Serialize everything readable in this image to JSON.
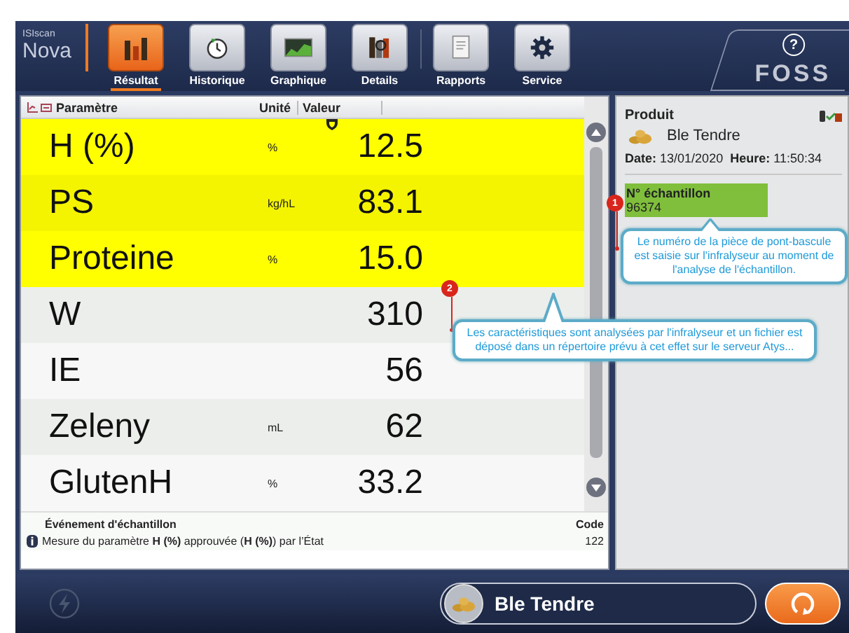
{
  "app": {
    "logo_small": "ISIscan",
    "logo_large": "Nova",
    "brand": "FOSS",
    "help": "?"
  },
  "tabs": [
    {
      "label": "Résultat",
      "selected": true
    },
    {
      "label": "Historique",
      "selected": false
    },
    {
      "label": "Graphique",
      "selected": false
    },
    {
      "label": "Details",
      "selected": false
    }
  ],
  "tools": [
    {
      "label": "Rapports"
    },
    {
      "label": "Service"
    }
  ],
  "table": {
    "columns": [
      "Paramètre",
      "Unité",
      "Valeur"
    ],
    "rows": [
      {
        "name": "H (%)",
        "unit": "%",
        "value": "12.5",
        "highlighted": true,
        "flagged": true
      },
      {
        "name": "PS",
        "unit": "kg/hL",
        "value": "83.1",
        "highlighted": true,
        "flagged": false
      },
      {
        "name": "Proteine",
        "unit": "%",
        "value": "15.0",
        "highlighted": true,
        "flagged": false
      },
      {
        "name": "W",
        "unit": "",
        "value": "310",
        "highlighted": false,
        "flagged": false
      },
      {
        "name": "IE",
        "unit": "",
        "value": "56",
        "highlighted": false,
        "flagged": false
      },
      {
        "name": "Zeleny",
        "unit": "mL",
        "value": "62",
        "highlighted": false,
        "flagged": false
      },
      {
        "name": "GlutenH",
        "unit": "%",
        "value": "33.2",
        "highlighted": false,
        "flagged": false
      }
    ]
  },
  "events": {
    "heading": "Événement d'échantillon",
    "code_heading": "Code",
    "rows": [
      {
        "text": "Mesure du paramètre **H (%)** approuvée (**H (%)**) par l’État",
        "code": "122"
      }
    ]
  },
  "product": {
    "title": "Produit",
    "name": "Ble Tendre",
    "date_label": "Date:",
    "date": "13/01/2020",
    "time_label": "Heure:",
    "time": "11:50:34",
    "sample_label": "N° échantillon",
    "sample_number": "96374"
  },
  "callouts": [
    {
      "number": "1",
      "text": "Le numéro de la pièce de pont-bascule est saisie sur l'infralyseur au moment de l'analyse de l'échantillon."
    },
    {
      "number": "2",
      "text": "Les caractéristiques sont analysées par l'infralyseur et un fichier est déposé dans un répertoire prévu à cet effet sur le serveur Atys..."
    }
  ],
  "footer": {
    "product": "Ble Tendre"
  }
}
